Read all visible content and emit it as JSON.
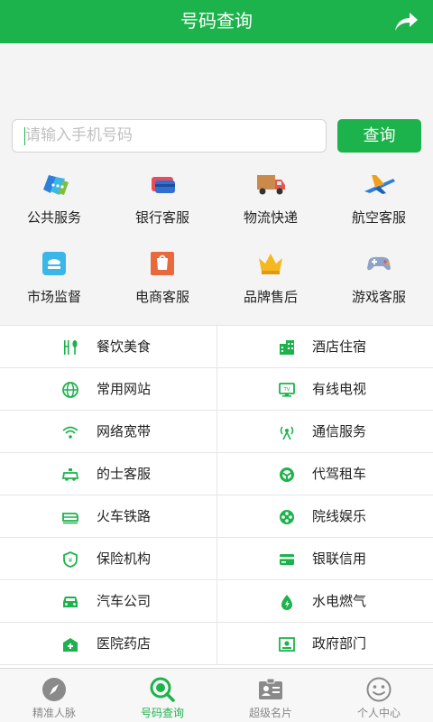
{
  "header": {
    "title": "号码查询",
    "share_icon": "share-icon"
  },
  "search": {
    "placeholder": "请输入手机号码",
    "button_label": "查询"
  },
  "categories": [
    {
      "label": "公共服务",
      "icon": "public-service-icon"
    },
    {
      "label": "银行客服",
      "icon": "bank-card-icon"
    },
    {
      "label": "物流快递",
      "icon": "delivery-truck-icon"
    },
    {
      "label": "航空客服",
      "icon": "airplane-icon"
    },
    {
      "label": "市场监督",
      "icon": "market-supervision-icon"
    },
    {
      "label": "电商客服",
      "icon": "ecommerce-icon"
    },
    {
      "label": "品牌售后",
      "icon": "crown-icon"
    },
    {
      "label": "游戏客服",
      "icon": "gamepad-icon"
    }
  ],
  "services": [
    {
      "left": "餐饮美食",
      "right": "酒店住宿"
    },
    {
      "left": "常用网站",
      "right": "有线电视"
    },
    {
      "left": "网络宽带",
      "right": "通信服务"
    },
    {
      "left": "的士客服",
      "right": "代驾租车"
    },
    {
      "left": "火车铁路",
      "right": "院线娱乐"
    },
    {
      "left": "保险机构",
      "right": "银联信用"
    },
    {
      "left": "汽车公司",
      "right": "水电燃气"
    },
    {
      "left": "医院药店",
      "right": "政府部门"
    }
  ],
  "tabs": [
    {
      "label": "精准人脉",
      "icon": "compass-icon",
      "active": false
    },
    {
      "label": "号码查询",
      "icon": "search-icon",
      "active": true
    },
    {
      "label": "超级名片",
      "icon": "business-card-icon",
      "active": false
    },
    {
      "label": "个人中心",
      "icon": "smiley-icon",
      "active": false
    }
  ],
  "colors": {
    "primary": "#1db34c",
    "background": "#f4f4f4"
  }
}
